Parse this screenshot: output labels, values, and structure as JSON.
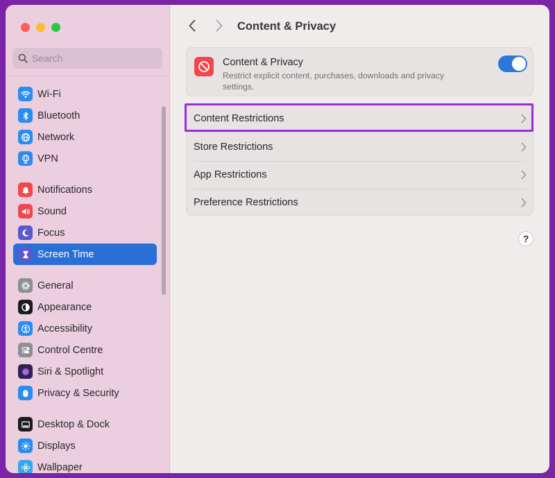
{
  "window": {
    "title": "Content & Privacy"
  },
  "search": {
    "placeholder": "Search"
  },
  "sidebar": {
    "items": [
      {
        "label": "Wi-Fi",
        "icon": "wifi-icon",
        "color": "#2b8cf0"
      },
      {
        "label": "Bluetooth",
        "icon": "bluetooth-icon",
        "color": "#2b8cf0"
      },
      {
        "label": "Network",
        "icon": "globe-icon",
        "color": "#2b8cf0"
      },
      {
        "label": "VPN",
        "icon": "vpn-globe-icon",
        "color": "#2b8cf0"
      },
      {
        "label": "Notifications",
        "icon": "bell-icon",
        "color": "#f2474d"
      },
      {
        "label": "Sound",
        "icon": "speaker-icon",
        "color": "#f2474d"
      },
      {
        "label": "Focus",
        "icon": "moon-icon",
        "color": "#5b57cf"
      },
      {
        "label": "Screen Time",
        "icon": "hourglass-icon",
        "color": "#5b57cf",
        "active": true
      },
      {
        "label": "General",
        "icon": "gear-icon",
        "color": "#8e8e93"
      },
      {
        "label": "Appearance",
        "icon": "appearance-icon",
        "color": "#1c1c1e"
      },
      {
        "label": "Accessibility",
        "icon": "accessibility-icon",
        "color": "#2b8cf0"
      },
      {
        "label": "Control Centre",
        "icon": "toggles-icon",
        "color": "#8e8e93"
      },
      {
        "label": "Siri & Spotlight",
        "icon": "siri-icon",
        "color": "#2d2250"
      },
      {
        "label": "Privacy & Security",
        "icon": "hand-icon",
        "color": "#2b8cf0"
      },
      {
        "label": "Desktop & Dock",
        "icon": "dock-icon",
        "color": "#1c1c1e"
      },
      {
        "label": "Displays",
        "icon": "sun-icon",
        "color": "#2b8cf0"
      },
      {
        "label": "Wallpaper",
        "icon": "flower-icon",
        "color": "#34a8e8"
      }
    ]
  },
  "main": {
    "feature": {
      "title": "Content & Privacy",
      "description": "Restrict explicit content, purchases, downloads and privacy settings.",
      "enabled": true,
      "icon": "no-entry-icon",
      "icon_color": "#f4454a"
    },
    "rows": [
      {
        "label": "Content Restrictions",
        "highlighted": true
      },
      {
        "label": "Store Restrictions"
      },
      {
        "label": "App Restrictions"
      },
      {
        "label": "Preference Restrictions"
      }
    ],
    "help_label": "?"
  },
  "colors": {
    "accent": "#2a6fd6",
    "highlight_border": "#9a2ce0",
    "background_frame": "#7c24a8"
  }
}
